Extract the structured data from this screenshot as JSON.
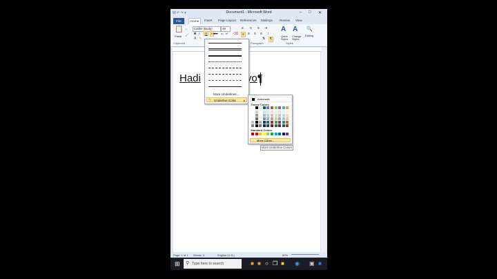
{
  "app": {
    "title": "Document1 - Microsoft Word",
    "qat": "W  ↶ ↷ ▾"
  },
  "window_controls": {
    "minimize": "–",
    "maximize": "□",
    "close": "✕"
  },
  "tabs": [
    {
      "label": "File"
    },
    {
      "label": "Home"
    },
    {
      "label": "Insert"
    },
    {
      "label": "Page Layout"
    },
    {
      "label": "References"
    },
    {
      "label": "Mailings"
    },
    {
      "label": "Review"
    },
    {
      "label": "View"
    }
  ],
  "ribbon": {
    "paste_label": "Paste",
    "font_name": "Calibri (Body)",
    "font_size": "48",
    "quick_styles": "Quick Styles",
    "change_styles": "Change Styles",
    "editing": "Editing",
    "groups": {
      "clipboard": "Clipboard",
      "paragraph": "Paragraph",
      "styles": "Styles"
    },
    "bold": "B",
    "italic": "I",
    "underline": "U"
  },
  "document": {
    "text_before": "Hadi",
    "text_after": "yo",
    "pilcrow": "¶"
  },
  "underline_menu": {
    "more_underlines": "More Underlines...",
    "underline_color": "Underline Color"
  },
  "color_menu": {
    "automatic": "Automatic",
    "theme_colors": "Theme Colors",
    "standard_colors": "Standard Colors",
    "more_colors": "More Colors...",
    "theme_top": [
      "#ffffff",
      "#000000",
      "#eeece1",
      "#1f497d",
      "#4f81bd",
      "#c0504d",
      "#9bbb59",
      "#8064a2",
      "#4bacc6",
      "#f79646"
    ],
    "standard": [
      "#c00000",
      "#ff0000",
      "#ffc000",
      "#ffff00",
      "#92d050",
      "#00b050",
      "#00b0f0",
      "#0070c0",
      "#002060",
      "#7030a0"
    ]
  },
  "tooltip": "More Underline Colors",
  "status": {
    "page": "Page: 1 of 1",
    "words": "Words: 3",
    "language": "English (U.S.)",
    "zoom": "80%"
  },
  "taskbar": {
    "search_placeholder": "Type here to search"
  }
}
